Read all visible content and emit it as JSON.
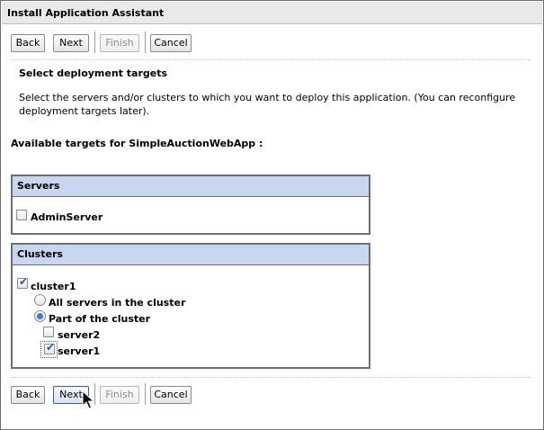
{
  "window": {
    "title": "Install Application Assistant"
  },
  "toolbar_top": {
    "back": "Back",
    "next": "Next",
    "finish": "Finish",
    "cancel": "Cancel"
  },
  "step": {
    "title": "Select deployment targets",
    "description": "Select the servers and/or clusters to which you want to deploy this application. (You can reconfigure deployment targets later).",
    "available_label": "Available targets for SimpleAuctionWebApp :"
  },
  "servers": {
    "header": "Servers",
    "items": [
      {
        "label": "AdminServer",
        "checked": false
      }
    ]
  },
  "clusters": {
    "header": "Clusters",
    "cluster": {
      "label": "cluster1",
      "checked": true
    },
    "options": [
      {
        "label": "All servers in the cluster",
        "selected": false
      },
      {
        "label": "Part of the cluster",
        "selected": true
      }
    ],
    "members": [
      {
        "label": "server2",
        "checked": false
      },
      {
        "label": "server1",
        "checked": true
      }
    ]
  },
  "toolbar_bottom": {
    "back": "Back",
    "next": "Next",
    "finish": "Finish",
    "cancel": "Cancel"
  },
  "colors": {
    "group_header": "#c8d6ef",
    "check_accent": "#2a5ab0"
  }
}
